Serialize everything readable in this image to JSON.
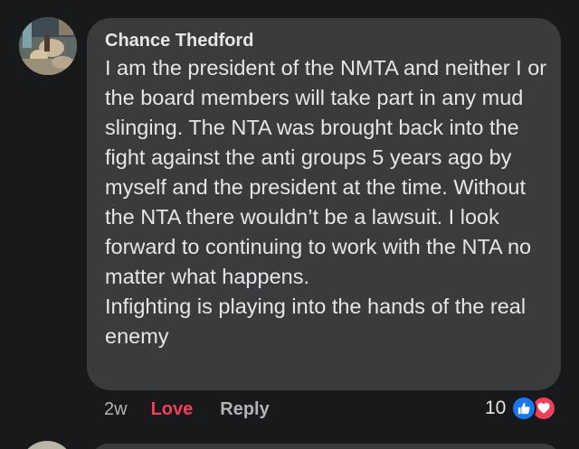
{
  "comment": {
    "author": "Chance Thedford",
    "text": "I am the president of the NMTA and neither I or the board members will take part in any mud slinging. The NTA was brought back into the fight against the anti groups 5 years ago by myself and the president at the time. Without the NTA there wouldn’t be a lawsuit. I look forward to continuing to work with the NTA no matter what happens.\n  Infighting is playing into the hands of the real enemy",
    "timestamp": "2w",
    "love_label": "Love",
    "reply_label": "Reply",
    "reaction_count": "10",
    "reactions": [
      "like-icon",
      "love-icon"
    ]
  },
  "colors": {
    "background": "#18191a",
    "bubble": "#3a3b3c",
    "text": "#e4e6eb",
    "muted": "#b0b3b8",
    "love": "#f33e58",
    "like": "#1877f2"
  }
}
